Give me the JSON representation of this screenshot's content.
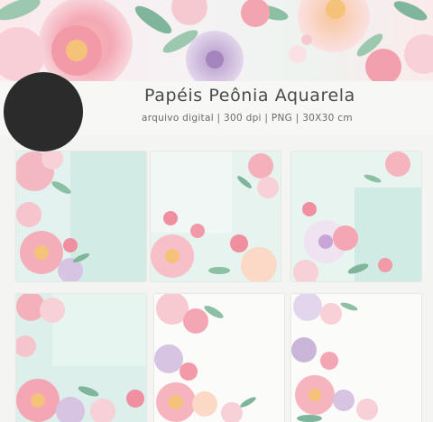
{
  "product": {
    "title": "Papéis Peônia Aquarela",
    "subtitle": "arquivo digital | 300 dpi | PNG  | 30X30 cm"
  },
  "colors": {
    "peony_pink": "#f3a7b3",
    "blush": "#f8d3d8",
    "mint": "#bfe3dc",
    "lavender": "#c9b6d8",
    "leaf_green": "#7fb59a",
    "dot": "#2b2b2b"
  },
  "papers": [
    {
      "id": "paper-1",
      "pattern": "left-border-mint"
    },
    {
      "id": "paper-2",
      "pattern": "corner-bouquets-mint"
    },
    {
      "id": "paper-3",
      "pattern": "left-bottom-mint"
    },
    {
      "id": "paper-4",
      "pattern": "left-border-mint-top"
    },
    {
      "id": "paper-5",
      "pattern": "left-cascade-white"
    },
    {
      "id": "paper-6",
      "pattern": "left-cascade-lavender"
    }
  ]
}
